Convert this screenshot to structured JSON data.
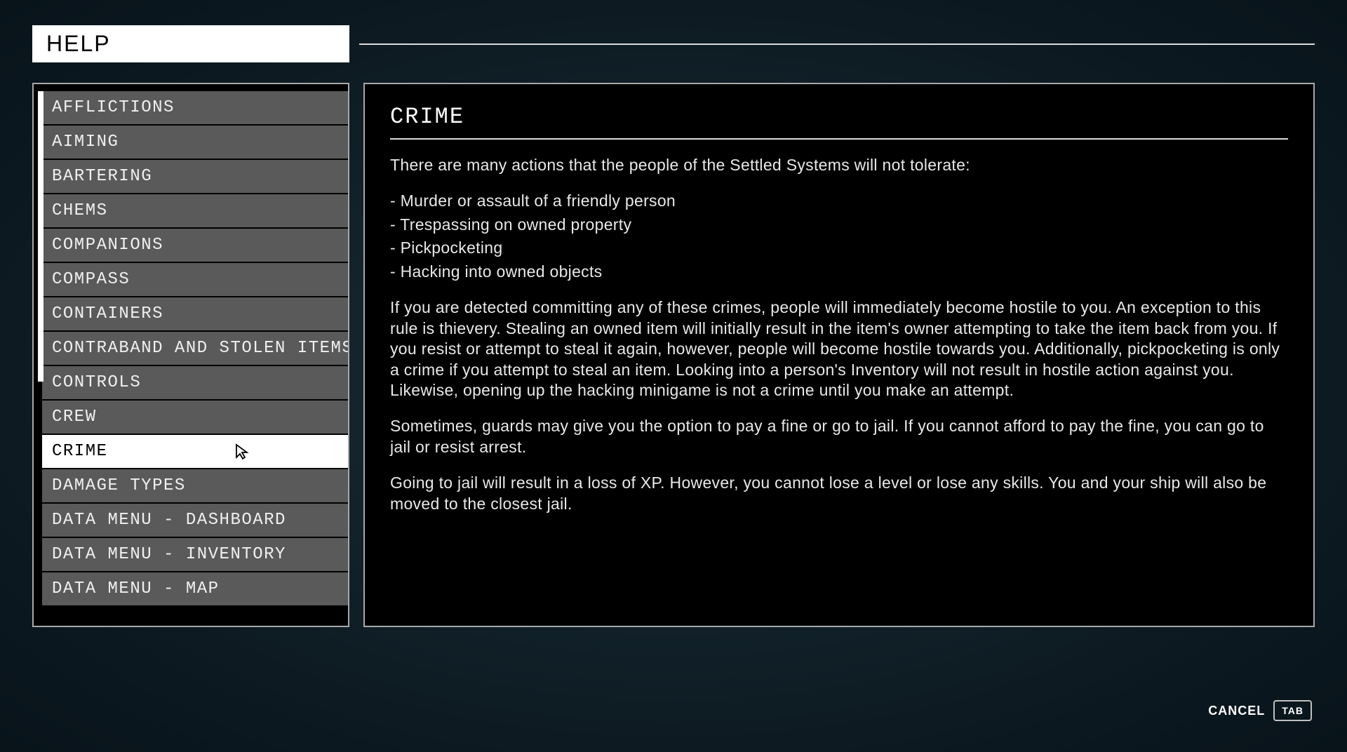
{
  "header": {
    "title": "HELP"
  },
  "sidebar": {
    "topics": [
      {
        "label": "AFFLICTIONS",
        "selected": false
      },
      {
        "label": "AIMING",
        "selected": false
      },
      {
        "label": "BARTERING",
        "selected": false
      },
      {
        "label": "CHEMS",
        "selected": false
      },
      {
        "label": "COMPANIONS",
        "selected": false
      },
      {
        "label": "COMPASS",
        "selected": false
      },
      {
        "label": "CONTAINERS",
        "selected": false
      },
      {
        "label": "CONTRABAND AND STOLEN ITEMS",
        "selected": false
      },
      {
        "label": "CONTROLS",
        "selected": false
      },
      {
        "label": "CREW",
        "selected": false
      },
      {
        "label": "CRIME",
        "selected": true
      },
      {
        "label": "DAMAGE TYPES",
        "selected": false
      },
      {
        "label": "DATA MENU - DASHBOARD",
        "selected": false
      },
      {
        "label": "DATA MENU - INVENTORY",
        "selected": false
      },
      {
        "label": "DATA MENU - MAP",
        "selected": false
      }
    ]
  },
  "content": {
    "title": "CRIME",
    "paragraphs": [
      "There are many actions that the people of the Settled Systems will not tolerate:",
      "- Murder or assault of a friendly person",
      "- Trespassing on owned property",
      "- Pickpocketing",
      "- Hacking into owned objects",
      "If you are detected committing any of these crimes, people will immediately become hostile to you. An exception to this rule is thievery. Stealing an owned item will initially result in the item's owner attempting to take the item back from you. If you resist or attempt to steal it again, however, people will become hostile towards you. Additionally, pickpocketing is only a crime if you attempt to steal an item. Looking into a person's Inventory will not result in hostile action against you. Likewise, opening up the hacking minigame is not a crime until you make an attempt.",
      "Sometimes, guards may give you the option to pay a fine or go to jail. If you cannot afford to pay the fine, you can go to jail or resist arrest.",
      "Going to jail will result in a loss of XP. However, you cannot lose a level or lose any skills. You and your ship will also be moved to the closest jail."
    ]
  },
  "footer": {
    "cancel_label": "CANCEL",
    "cancel_key": "TAB"
  }
}
